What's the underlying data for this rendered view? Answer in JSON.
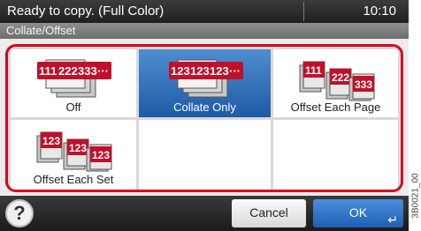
{
  "status_bar": {
    "message": "Ready to copy. (Full Color)",
    "time": "10:10"
  },
  "screen_title": "Collate/Offset",
  "options": [
    {
      "label": "Off",
      "icon": "collate-off-icon",
      "icon_text": [
        "111",
        "222",
        "333",
        "···"
      ],
      "selected": false
    },
    {
      "label": "Collate Only",
      "icon": "collate-only-icon",
      "icon_text": [
        "123",
        "123",
        "123",
        "···"
      ],
      "selected": true
    },
    {
      "label": "Offset Each Page",
      "icon": "offset-each-page-icon",
      "icon_text": [
        "111",
        "222",
        "333"
      ],
      "selected": false
    },
    {
      "label": "Offset Each Set",
      "icon": "offset-each-set-icon",
      "icon_text": [
        "123",
        "123",
        "123"
      ],
      "selected": false
    }
  ],
  "buttons": {
    "help": "?",
    "cancel": "Cancel",
    "ok": "OK",
    "ok_enter_icon": "↵"
  },
  "image_code": "3B0021_00",
  "colors": {
    "accent_red": "#d9001b",
    "selected_blue": "#2a6bbd"
  }
}
